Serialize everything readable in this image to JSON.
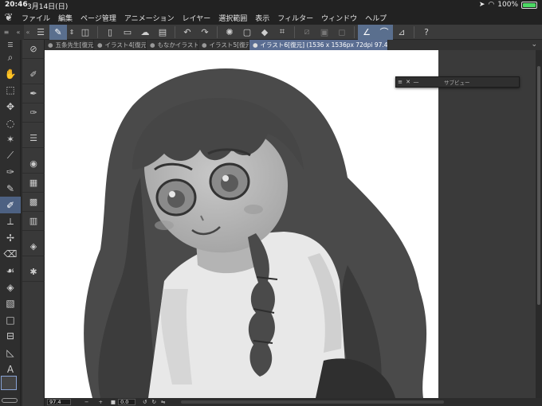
{
  "status": {
    "time": "20:46",
    "date": "3月14日(日)",
    "battery": "100%",
    "battery_level": 1.0
  },
  "menu": [
    "ファイル",
    "編集",
    "ページ管理",
    "アニメーション",
    "レイヤー",
    "選択範囲",
    "表示",
    "フィルター",
    "ウィンドウ",
    "ヘルプ"
  ],
  "tabs": [
    {
      "label": "五条先生[復元]*",
      "active": false
    },
    {
      "label": "イラスト4[復元",
      "active": false
    },
    {
      "label": "もなかイラスト",
      "active": false
    },
    {
      "label": "イラスト5[復元",
      "active": false
    },
    {
      "label": "イラスト6[復元] (1536 x 1536px 72dpi 97.4%)",
      "active": true
    }
  ],
  "panel": {
    "title": "サブビュー"
  },
  "bottom": {
    "zoom": "97.4",
    "rotation": "0.0"
  },
  "icons": {
    "tools": [
      "menu-icon",
      "zoom-icon",
      "hand-icon",
      "select-object-icon",
      "move-layer-icon",
      "lasso-icon",
      "magic-wand-icon",
      "eyedropper-icon",
      "pen-icon",
      "pencil-icon",
      "brush-icon",
      "airbrush-icon",
      "decoration-icon",
      "eraser-icon",
      "blend-icon",
      "fill-icon",
      "gradient-icon",
      "figure-icon",
      "frame-icon",
      "ruler-icon",
      "text-icon"
    ]
  }
}
